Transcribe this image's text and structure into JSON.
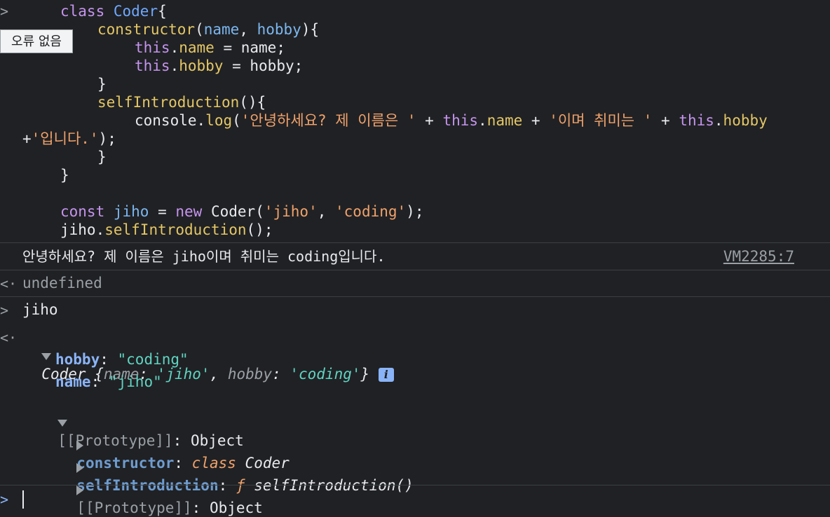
{
  "tooltip": "오류 없음",
  "code": {
    "l1_kw": "class",
    "l1_name": "Coder",
    "l1_brace": "{",
    "l2_ctor": "constructor",
    "l2_p1": "name",
    "l2_p2": "hobby",
    "l3_this": "this",
    "l3_prop": "name",
    "l3_val": "name;",
    "l4_this": "this",
    "l4_prop": "hobby",
    "l4_val": "hobby;",
    "l5": "}",
    "l6_method": "selfIntroduction",
    "l7_console": "console",
    "l7_log": "log",
    "l7_s1": "'안녕하세요? 제 이름은 '",
    "l7_this1": "this",
    "l7_name": "name",
    "l7_s2": "'이며 취미는 '",
    "l7_this2": "this",
    "l7_hobby": "hobby",
    "l8_s3": "'입니다.'",
    "l9": "}",
    "l10": "}",
    "l11_kw": "const",
    "l11_var": "jiho",
    "l11_new": "new",
    "l11_cls": "Coder",
    "l11_a1": "'jiho'",
    "l11_a2": "'coding'",
    "l12_obj": "jiho",
    "l12_method": "selfIntroduction"
  },
  "log_output": "안녕하세요? 제 이름은 jiho이며 취미는 coding입니다.",
  "log_source": "VM2285:7",
  "result_undefined": "undefined",
  "input_jiho": "jiho",
  "object": {
    "class_name": "Coder",
    "preview_name_key": "name",
    "preview_name_val": "'jiho'",
    "preview_hobby_key": "hobby",
    "preview_hobby_val": "'coding'",
    "hobby_key": "hobby",
    "hobby_val": "\"coding\"",
    "name_key": "name",
    "name_val": "\"jiho\"",
    "proto_key": "[[Prototype]]",
    "proto_val": "Object",
    "constructor_key": "constructor",
    "constructor_kw": "class",
    "constructor_val": "Coder",
    "method_key": "selfIntroduction",
    "method_f": "ƒ",
    "method_val": "selfIntroduction()",
    "proto2_key": "[[Prototype]]",
    "proto2_val": "Object",
    "info_badge": "i"
  },
  "colors": {
    "background": "#202124",
    "keyword": "#c594ee",
    "string": "#f0a26b",
    "function": "#e4c766",
    "link": "#8ab4f8"
  }
}
